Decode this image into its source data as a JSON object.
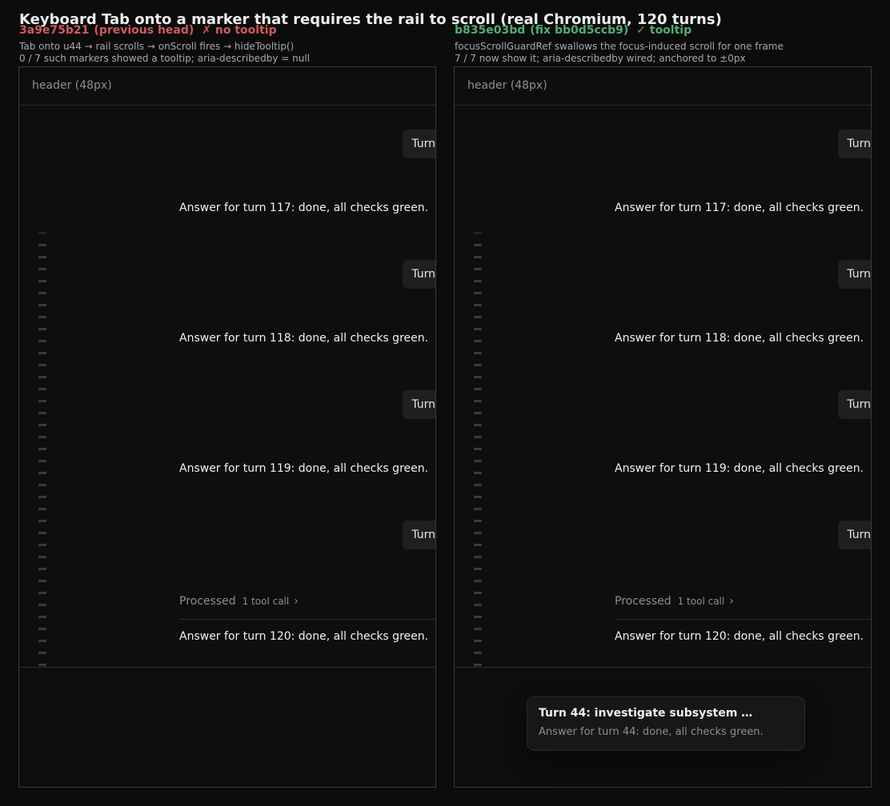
{
  "page": {
    "title": "Keyboard Tab onto a marker that requires the rail to scroll  (real Chromium, 120 turns)"
  },
  "colors": {
    "bad": "#d05a5a",
    "good": "#4fae6c",
    "background": "#0c0c0d"
  },
  "left": {
    "hash": "3a9e75b21",
    "label": "(previous head)",
    "status": "✗ no tooltip",
    "notes": [
      "Tab onto u44 → rail scrolls → onScroll fires → hideTooltip()",
      "0 / 7 such markers showed a tooltip; aria-describedby = null"
    ]
  },
  "right": {
    "hash": "b835e03bd",
    "label": "(fix bb0d5ccb9)",
    "status": "✓ tooltip",
    "notes": [
      "focusScrollGuardRef swallows the focus-induced scroll for one frame",
      "7 / 7 now show it; aria-describedby wired; anchored to ±0px"
    ],
    "tooltip": {
      "title": "Turn 44: investigate subsystem …",
      "body": "Answer for turn 44: done, all checks green."
    }
  },
  "frame": {
    "header": "header (48px)",
    "user_bubble": "Turn",
    "answers": [
      "Answer for turn 117: done, all checks green.",
      "Answer for turn 118: done, all checks green.",
      "Answer for turn 119: done, all checks green.",
      "Answer for turn 120: done, all checks green."
    ],
    "processed_label": "Processed",
    "tool_calls": "1 tool call",
    "rail_marker_count": 37
  }
}
